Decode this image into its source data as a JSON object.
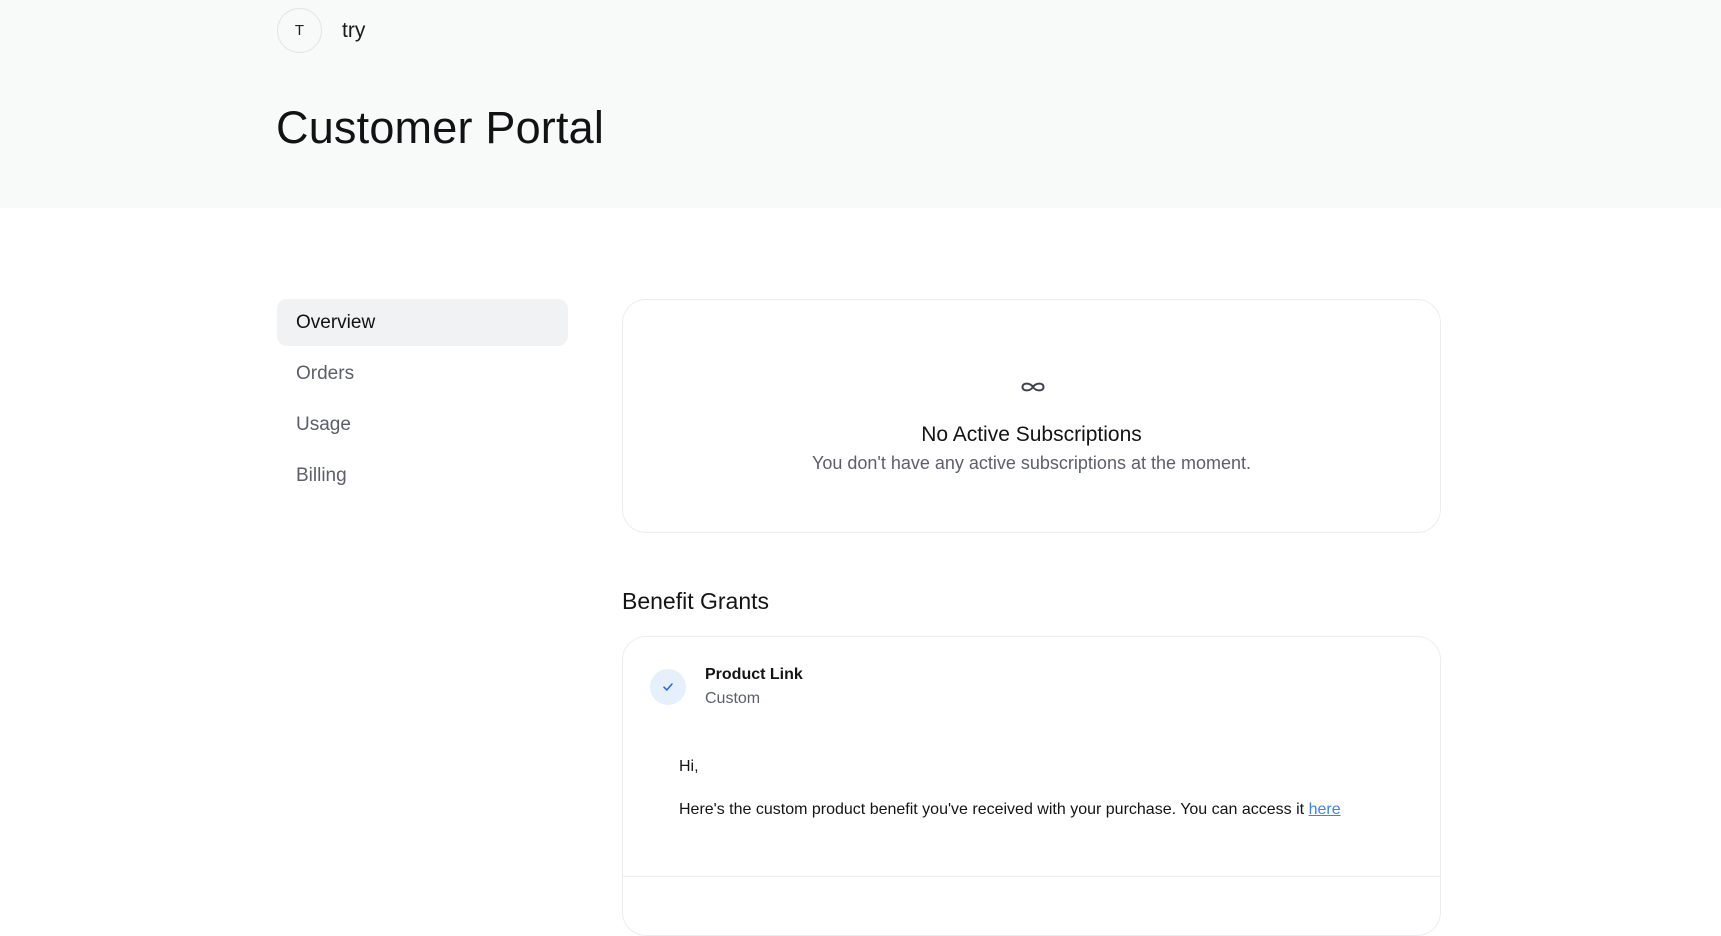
{
  "header": {
    "org_initial": "T",
    "org_name": "try",
    "page_title": "Customer Portal"
  },
  "sidebar": {
    "items": [
      {
        "label": "Overview",
        "active": true
      },
      {
        "label": "Orders",
        "active": false
      },
      {
        "label": "Usage",
        "active": false
      },
      {
        "label": "Billing",
        "active": false
      }
    ]
  },
  "subscriptions": {
    "icon": "infinity-icon",
    "title": "No Active Subscriptions",
    "description": "You don't have any active subscriptions at the moment."
  },
  "benefit_grants": {
    "section_title": "Benefit Grants",
    "items": [
      {
        "icon": "check-icon",
        "name": "Product Link",
        "type": "Custom",
        "greeting": "Hi,",
        "body": "Here's the custom product benefit you've received with your purchase. You can access it ",
        "link_text": "here"
      }
    ]
  },
  "colors": {
    "header_bg": "#f8f9f9",
    "active_nav_bg": "#f1f2f4",
    "link": "#3b82f6",
    "check_bg": "#e6f0fd"
  }
}
